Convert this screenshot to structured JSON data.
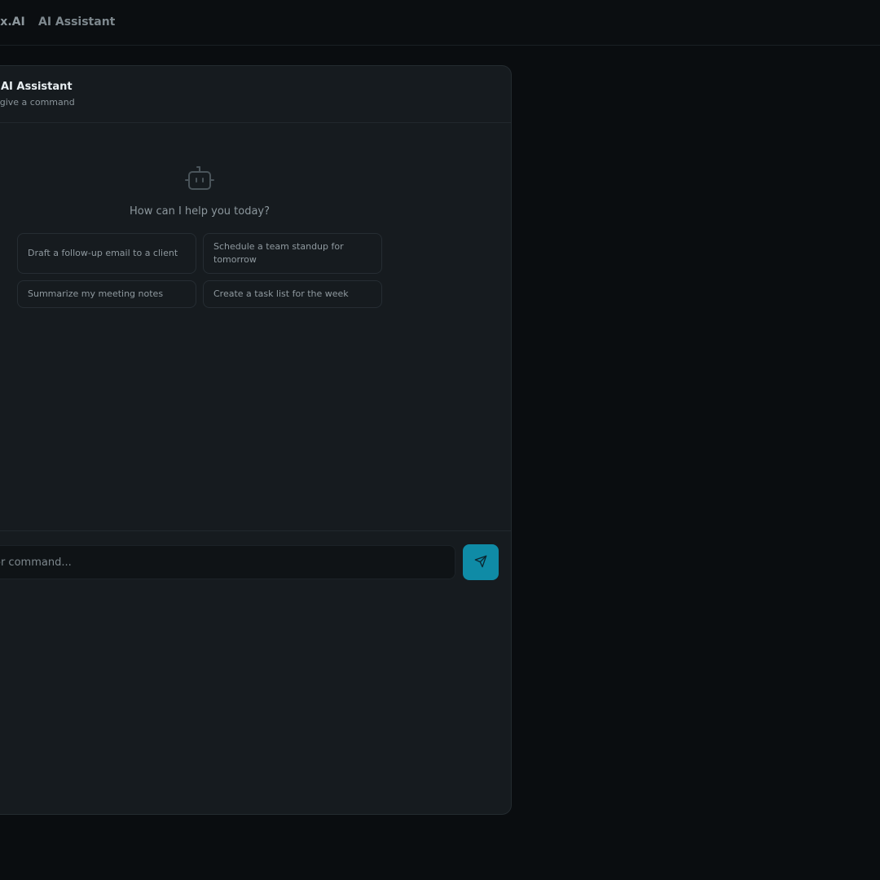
{
  "topbar": {
    "brand": "lex.AI",
    "section": "AI Assistant"
  },
  "panel": {
    "title": "AI Assistant",
    "subtitle": "or give a command"
  },
  "empty_state": {
    "icon": "robot-icon",
    "prompt": "How can I help you today?",
    "suggestions": [
      "Draft a follow-up email to a client",
      "Schedule a team standup for tomorrow",
      "Summarize my meeting notes",
      "Create a task list for the week"
    ]
  },
  "composer": {
    "placeholder": "or command...",
    "value": "",
    "send_icon": "send-icon"
  },
  "colors": {
    "background": "#0a0d10",
    "panel": "#161b1f",
    "accent": "#0f8ba6",
    "text_muted": "#8c979d"
  }
}
